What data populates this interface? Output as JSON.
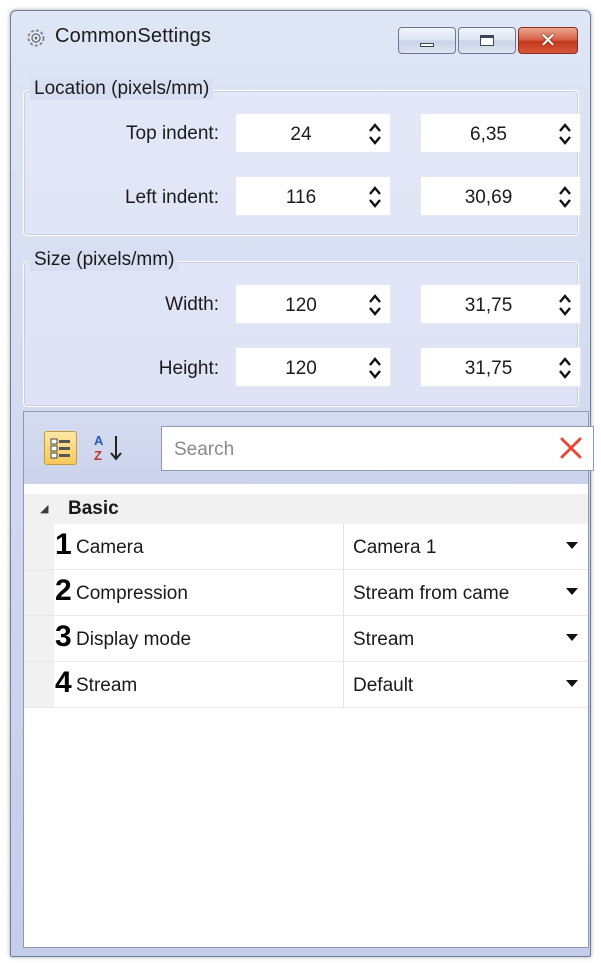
{
  "window": {
    "title": "CommonSettings",
    "icons": {
      "app": "gear-icon",
      "minimize": "minimize-icon",
      "maximize": "maximize-icon",
      "close": "close-icon"
    }
  },
  "location": {
    "legend": "Location (pixels/mm)",
    "top": {
      "label": "Top indent:",
      "pixels": "24",
      "mm": "6,35"
    },
    "left": {
      "label": "Left indent:",
      "pixels": "116",
      "mm": "30,69"
    }
  },
  "size": {
    "legend": "Size (pixels/mm)",
    "width": {
      "label": "Width:",
      "pixels": "120",
      "mm": "31,75"
    },
    "height": {
      "label": "Height:",
      "pixels": "120",
      "mm": "31,75"
    }
  },
  "propgrid": {
    "search_placeholder": "Search",
    "category": "Basic",
    "rows": [
      {
        "num": "1",
        "name": "Camera",
        "value": "Camera 1"
      },
      {
        "num": "2",
        "name": "Compression",
        "value": "Stream from came"
      },
      {
        "num": "3",
        "name": "Display mode",
        "value": "Stream"
      },
      {
        "num": "4",
        "name": "Stream",
        "value": "Default"
      }
    ]
  },
  "colors": {
    "window_bg": "#cdd6ee",
    "close_red": "#c23b1e",
    "selected_btn": "#f7c85a"
  }
}
